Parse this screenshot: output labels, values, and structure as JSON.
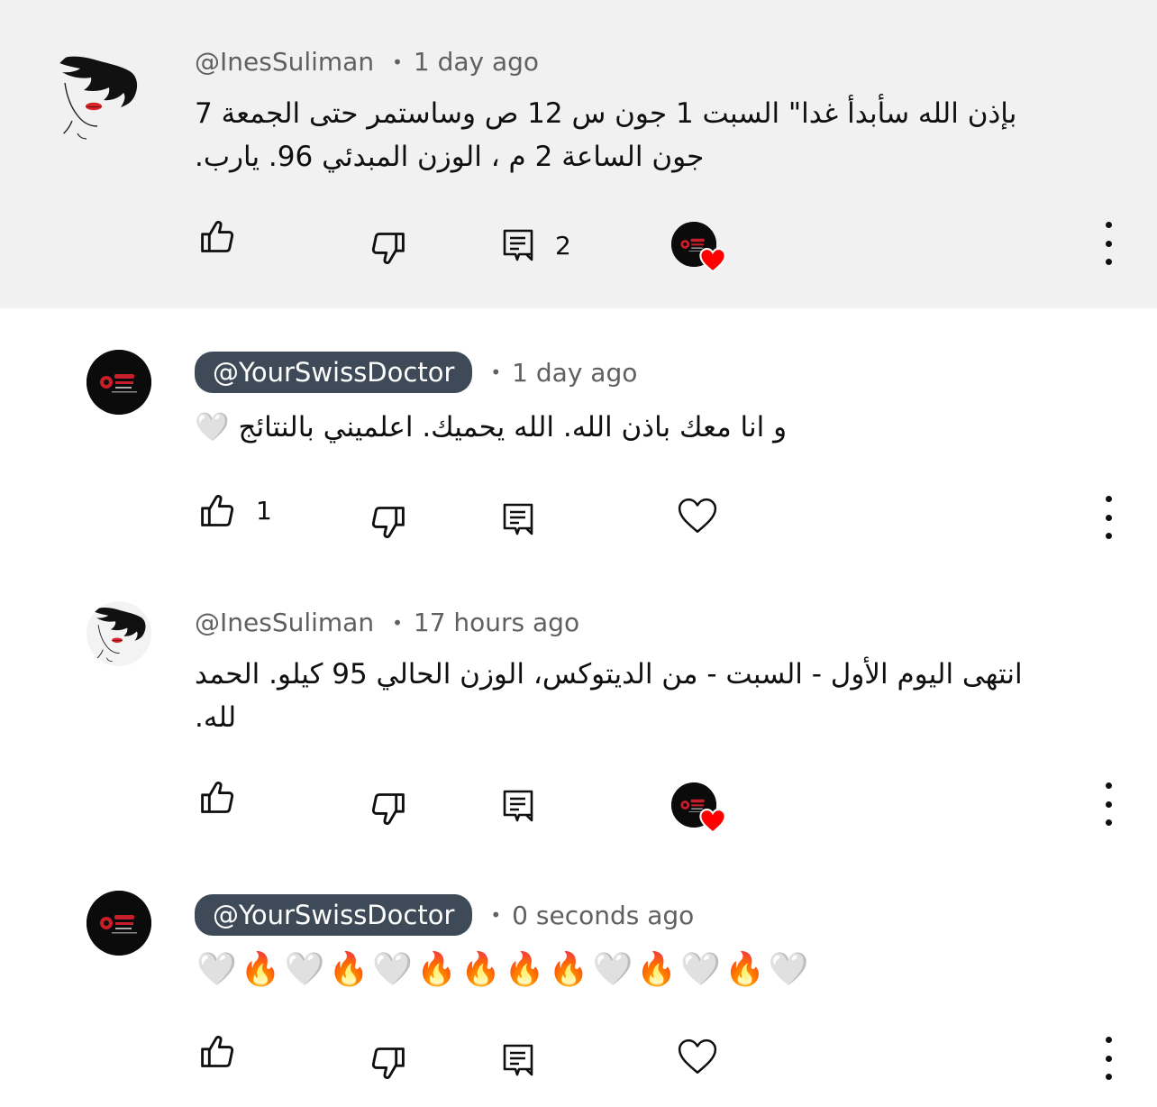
{
  "comments": [
    {
      "handle": "@InesSuliman",
      "time": "1 day ago",
      "text_line1": "بإذن الله سأبدأ غدا\" السبت 1 جون س 12 ص وساستمر حتى الجمعة 7",
      "text_line2": "جون الساعة 2 م ، الوزن المبدئي 96. يارب.",
      "replies_count": "2",
      "creator_hearted": true
    },
    {
      "handle": "@YourSwissDoctor",
      "time": "1 day ago",
      "text": "و انا معك باذن الله. الله يحميك. اعلميني بالنتائج 🤍",
      "likes_count": "1",
      "creator_hearted": false
    },
    {
      "handle": "@InesSuliman",
      "time": "17 hours ago",
      "text_line1": "انتهى اليوم الأول - السبت - من الديتوكس، الوزن الحالي 95 كيلو. الحمد",
      "text_line2": "لله.",
      "creator_hearted": true
    },
    {
      "handle": "@YourSwissDoctor",
      "time": "0 seconds ago",
      "emojis": [
        "🤍",
        "🔥",
        "🤍",
        "🔥",
        "🤍",
        "🔥",
        "🔥",
        "🔥",
        "🔥",
        "🤍",
        "🔥",
        "🤍",
        "🔥",
        "🤍"
      ],
      "creator_hearted": false
    }
  ],
  "icons": {
    "like": "thumbs-up-icon",
    "dislike": "thumbs-down-icon",
    "reply": "comment-reply-icon",
    "heart": "heart-outline-icon",
    "more": "more-vertical-icon"
  },
  "colors": {
    "highlight_bg": "#f1f1f1",
    "creator_pill": "#3e4a57",
    "heart_red": "#ff0000"
  }
}
